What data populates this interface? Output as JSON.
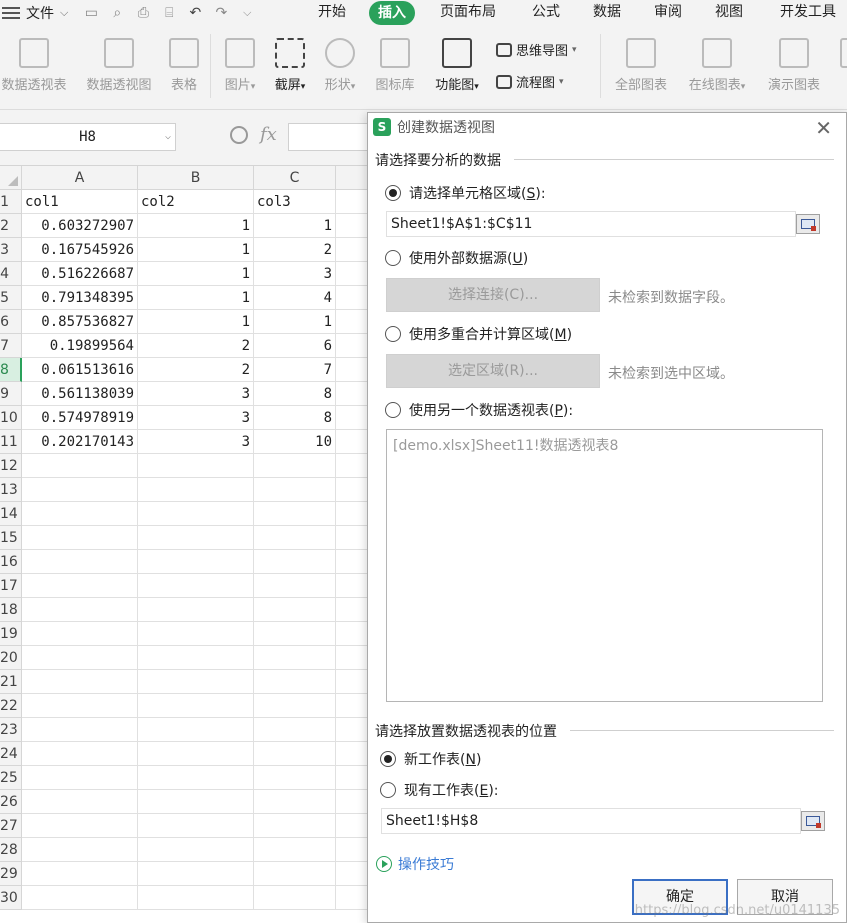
{
  "ribbon_tabs": {
    "file": "文件",
    "start": "开始",
    "insert": "插入",
    "page_layout": "页面布局",
    "formula": "公式",
    "data": "数据",
    "review": "审阅",
    "view": "视图",
    "developer": "开发工具"
  },
  "toolbar": {
    "pivot_table": "数据透视表",
    "pivot_chart": "数据透视图",
    "table": "表格",
    "picture": "图片",
    "screenshot": "截屏",
    "shapes": "形状",
    "icon_lib": "图标库",
    "function_chart": "功能图",
    "mind_map": "思维导图",
    "flowchart": "流程图",
    "all_charts": "全部图表",
    "online_charts": "在线图表",
    "demo_charts": "演示图表"
  },
  "formula_bar": {
    "name_box": "H8",
    "fx": "fx"
  },
  "sheet": {
    "columns": [
      "A",
      "B",
      "C"
    ],
    "rows": [
      {
        "n": "1",
        "a": "col1",
        "b": "col2",
        "c": "col3"
      },
      {
        "n": "2",
        "a": "0.603272907",
        "b": "1",
        "c": "1"
      },
      {
        "n": "3",
        "a": "0.167545926",
        "b": "1",
        "c": "2"
      },
      {
        "n": "4",
        "a": "0.516226687",
        "b": "1",
        "c": "3"
      },
      {
        "n": "5",
        "a": "0.791348395",
        "b": "1",
        "c": "4"
      },
      {
        "n": "6",
        "a": "0.857536827",
        "b": "1",
        "c": "1"
      },
      {
        "n": "7",
        "a": "0.19899564",
        "b": "2",
        "c": "6"
      },
      {
        "n": "8",
        "a": "0.061513616",
        "b": "2",
        "c": "7"
      },
      {
        "n": "9",
        "a": "0.561138039",
        "b": "3",
        "c": "8"
      },
      {
        "n": "10",
        "a": "0.574978919",
        "b": "3",
        "c": "8"
      },
      {
        "n": "11",
        "a": "0.202170143",
        "b": "3",
        "c": "10"
      },
      {
        "n": "12"
      },
      {
        "n": "13"
      },
      {
        "n": "14"
      },
      {
        "n": "15"
      },
      {
        "n": "16"
      },
      {
        "n": "17"
      },
      {
        "n": "18"
      },
      {
        "n": "19"
      },
      {
        "n": "20"
      },
      {
        "n": "21"
      },
      {
        "n": "22"
      },
      {
        "n": "23"
      },
      {
        "n": "24"
      },
      {
        "n": "25"
      },
      {
        "n": "26"
      },
      {
        "n": "27"
      },
      {
        "n": "28"
      },
      {
        "n": "29"
      },
      {
        "n": "30"
      }
    ]
  },
  "dialog": {
    "title": "创建数据透视图",
    "section_source": "请选择要分析的数据",
    "opt_range_label": "请选择单元格区域(",
    "opt_range_key": "S",
    "opt_range_tail": "):",
    "range_value": "Sheet1!$A$1:$C$11",
    "opt_external_label": "使用外部数据源(",
    "opt_external_key": "U",
    "opt_external_tail": ")",
    "choose_connection": "选择连接(C)...",
    "no_fields_hint": "未检索到数据字段。",
    "opt_consolidate_label": "使用多重合并计算区域(",
    "opt_consolidate_key": "M",
    "opt_consolidate_tail": ")",
    "select_region": "选定区域(R)...",
    "no_region_hint": "未检索到选中区域。",
    "opt_other_pivot_label": "使用另一个数据透视表(",
    "opt_other_pivot_key": "P",
    "opt_other_pivot_tail": "):",
    "pivot_list_item": "[demo.xlsx]Sheet11!数据透视表8",
    "section_location": "请选择放置数据透视表的位置",
    "opt_new_sheet_label": "新工作表(",
    "opt_new_sheet_key": "N",
    "opt_new_sheet_tail": ")",
    "opt_existing_label": "现有工作表(",
    "opt_existing_key": "E",
    "opt_existing_tail": "):",
    "location_value": "Sheet1!$H$8",
    "tips": "操作技巧",
    "ok": "确定",
    "cancel": "取消"
  },
  "watermark": "https://blog.csdn.net/u0141135"
}
